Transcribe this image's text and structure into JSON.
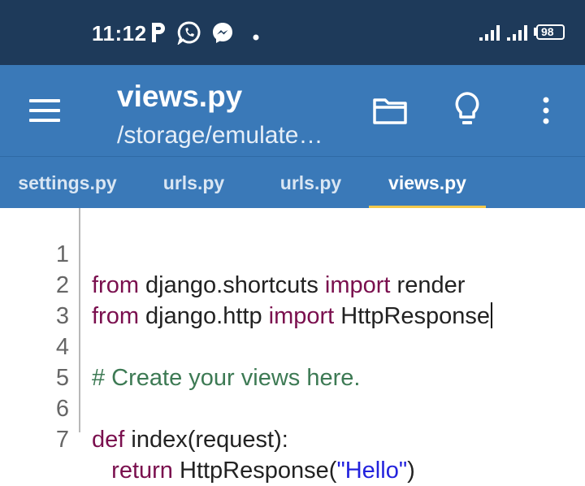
{
  "status_bar": {
    "time": "11:12",
    "icons": [
      "parking-app-icon",
      "whatsapp-icon",
      "messenger-icon",
      "dot-icon",
      "signal-icon",
      "signal-icon",
      "battery-icon"
    ],
    "battery_level": "98"
  },
  "app_bar": {
    "title": "views.py",
    "subtitle": "/storage/emulate…",
    "actions": [
      "menu-icon",
      "folder-icon",
      "lightbulb-icon",
      "more-vert-icon"
    ]
  },
  "tabs": [
    {
      "label": "settings.py",
      "active": false
    },
    {
      "label": "urls.py",
      "active": false
    },
    {
      "label": "urls.py",
      "active": false
    },
    {
      "label": "views.py",
      "active": true
    }
  ],
  "editor": {
    "line_numbers": [
      "1",
      "2",
      "3",
      "4",
      "5",
      "6",
      "7"
    ],
    "lines": {
      "l1": {
        "kw1": "from",
        "t1": " django.shortcuts ",
        "kw2": "import",
        "t2": " render"
      },
      "l2": {
        "kw1": "from",
        "t1": " django.http ",
        "kw2": "import",
        "t2": " HttpResponse"
      },
      "l4": {
        "comment": "# Create your views here."
      },
      "l6": {
        "kw1": "def",
        "t1": " index(request):"
      },
      "l7": {
        "indent": "   ",
        "kw1": "return",
        "t1": " HttpResponse(",
        "str": "\"Hello\"",
        "t2": ")"
      }
    }
  },
  "colors": {
    "status_bar_bg": "#1e3a5a",
    "app_bar_bg": "#3a79b8",
    "tab_indicator": "#f2c84b",
    "keyword": "#7a0f4e",
    "comment": "#3d7a54",
    "string": "#2222dd"
  }
}
